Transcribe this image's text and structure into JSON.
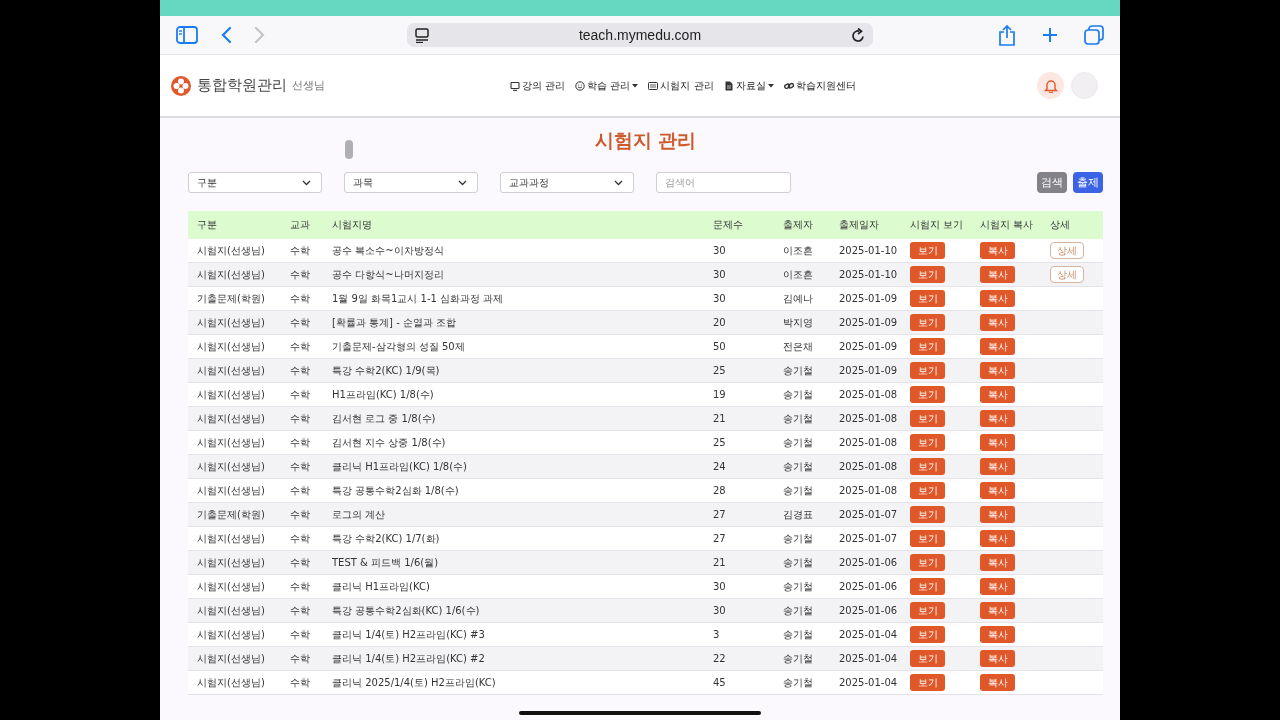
{
  "browser": {
    "url": "teach.mymedu.com"
  },
  "header": {
    "logo": "통합학원관리",
    "role": "선생님",
    "nav": [
      {
        "label": "강의 관리",
        "dropdown": false
      },
      {
        "label": "학습 관리",
        "dropdown": true
      },
      {
        "label": "시험지 관리",
        "dropdown": false
      },
      {
        "label": "자료실",
        "dropdown": true
      },
      {
        "label": "학습지원센터",
        "dropdown": false
      }
    ]
  },
  "page": {
    "title": "시험지 관리",
    "filters": [
      {
        "placeholder": "구분"
      },
      {
        "placeholder": "과목"
      },
      {
        "placeholder": "교과과정"
      }
    ],
    "search": {
      "placeholder": "검색어"
    },
    "buttons": [
      {
        "label": "검색",
        "kind": "search"
      },
      {
        "label": "출제",
        "kind": "create"
      }
    ]
  },
  "table": {
    "columns": [
      "구분",
      "교과",
      "시험지명",
      "문제수",
      "출제자",
      "출제일자",
      "시험지 보기",
      "시험지 복사",
      "상세"
    ],
    "rows": [
      {
        "type": "시험지(선생님)",
        "subject": "수학",
        "name": "공수 복소수~이차방정식",
        "count": "30",
        "author": "이조흔",
        "date": "2025-01-10",
        "view": "보기",
        "copy": "복사",
        "detail": "상세"
      },
      {
        "type": "시험지(선생님)",
        "subject": "수학",
        "name": "공수 다항식~나머지정리",
        "count": "30",
        "author": "이조흔",
        "date": "2025-01-10",
        "view": "보기",
        "copy": "복사",
        "detail": "상세"
      },
      {
        "type": "기출문제(학원)",
        "subject": "수학",
        "name": "1월 9일 화목1교시 1-1 심화과정 과제",
        "count": "30",
        "author": "김예나",
        "date": "2025-01-09",
        "view": "보기",
        "copy": "복사"
      },
      {
        "type": "시험지(선생님)",
        "subject": "수학",
        "name": "[확률과 통계] - 순열과 조합",
        "count": "20",
        "author": "박지영",
        "date": "2025-01-09",
        "view": "보기",
        "copy": "복사"
      },
      {
        "type": "시험지(선생님)",
        "subject": "수학",
        "name": "기출문제-삼각형의 성질 50제",
        "count": "50",
        "author": "전은채",
        "date": "2025-01-09",
        "view": "보기",
        "copy": "복사"
      },
      {
        "type": "시험지(선생님)",
        "subject": "수학",
        "name": "특강 수학2(KC) 1/9(목)",
        "count": "25",
        "author": "송기철",
        "date": "2025-01-09",
        "view": "보기",
        "copy": "복사"
      },
      {
        "type": "시험지(선생님)",
        "subject": "수학",
        "name": "H1프라임(KC) 1/8(수)",
        "count": "19",
        "author": "송기철",
        "date": "2025-01-08",
        "view": "보기",
        "copy": "복사"
      },
      {
        "type": "시험지(선생님)",
        "subject": "수학",
        "name": "김서현 로그 중 1/8(수)",
        "count": "21",
        "author": "송기철",
        "date": "2025-01-08",
        "view": "보기",
        "copy": "복사"
      },
      {
        "type": "시험지(선생님)",
        "subject": "수학",
        "name": "김서현 지수 상중 1/8(수)",
        "count": "25",
        "author": "송기철",
        "date": "2025-01-08",
        "view": "보기",
        "copy": "복사"
      },
      {
        "type": "시험지(선생님)",
        "subject": "수학",
        "name": "클리닉 H1프라임(KC) 1/8(수)",
        "count": "24",
        "author": "송기철",
        "date": "2025-01-08",
        "view": "보기",
        "copy": "복사"
      },
      {
        "type": "시험지(선생님)",
        "subject": "수학",
        "name": "특강 공통수학2심화 1/8(수)",
        "count": "28",
        "author": "송기철",
        "date": "2025-01-08",
        "view": "보기",
        "copy": "복사"
      },
      {
        "type": "기출문제(학원)",
        "subject": "수학",
        "name": "로그의 계산",
        "count": "27",
        "author": "김경표",
        "date": "2025-01-07",
        "view": "보기",
        "copy": "복사"
      },
      {
        "type": "시험지(선생님)",
        "subject": "수학",
        "name": "특강 수학2(KC) 1/7(화)",
        "count": "27",
        "author": "송기철",
        "date": "2025-01-07",
        "view": "보기",
        "copy": "복사"
      },
      {
        "type": "시험지(선생님)",
        "subject": "수학",
        "name": "TEST & 피드백 1/6(월)",
        "count": "21",
        "author": "송기철",
        "date": "2025-01-06",
        "view": "보기",
        "copy": "복사"
      },
      {
        "type": "시험지(선생님)",
        "subject": "수학",
        "name": "클리닉 H1프라임(KC)",
        "count": "30",
        "author": "송기철",
        "date": "2025-01-06",
        "view": "보기",
        "copy": "복사"
      },
      {
        "type": "시험지(선생님)",
        "subject": "수학",
        "name": "특강 공통수학2심화(KC) 1/6(수)",
        "count": "30",
        "author": "송기철",
        "date": "2025-01-06",
        "view": "보기",
        "copy": "복사"
      },
      {
        "type": "시험지(선생님)",
        "subject": "수학",
        "name": "클리닉 1/4(토) H2프라임(KC) #3",
        "count": "3",
        "author": "송기철",
        "date": "2025-01-04",
        "view": "보기",
        "copy": "복사"
      },
      {
        "type": "시험지(선생님)",
        "subject": "수학",
        "name": "클리닉 1/4(토) H2프라임(KC) #2",
        "count": "22",
        "author": "송기철",
        "date": "2025-01-04",
        "view": "보기",
        "copy": "복사"
      },
      {
        "type": "시험지(선생님)",
        "subject": "수학",
        "name": "클리닉 2025/1/4(토) H2프라임(KC)",
        "count": "45",
        "author": "송기철",
        "date": "2025-01-04",
        "view": "보기",
        "copy": "복사"
      }
    ]
  }
}
